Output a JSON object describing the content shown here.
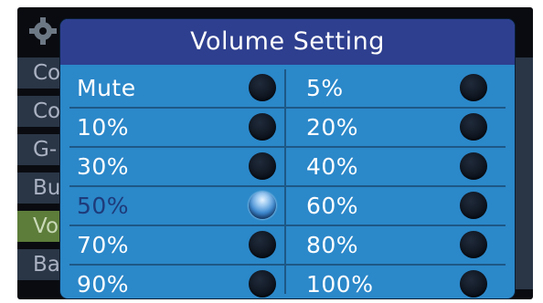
{
  "background_menu": {
    "items": [
      {
        "label": "Co"
      },
      {
        "label": "Co"
      },
      {
        "label": "G-"
      },
      {
        "label": "Bu"
      },
      {
        "label": "Vo",
        "selected": true
      },
      {
        "label": "Ba"
      }
    ]
  },
  "dialog": {
    "title": "Volume Setting",
    "selected": "50%",
    "rows": [
      {
        "left": "Mute",
        "right": "5%"
      },
      {
        "left": "10%",
        "right": "20%"
      },
      {
        "left": "30%",
        "right": "40%"
      },
      {
        "left": "50%",
        "right": "60%"
      },
      {
        "left": "70%",
        "right": "80%"
      },
      {
        "left": "90%",
        "right": "100%"
      }
    ]
  },
  "colors": {
    "title_bar": "#2e3f8f",
    "dialog_bg": "#2b88c9",
    "selected_text": "#1e3b7a"
  }
}
